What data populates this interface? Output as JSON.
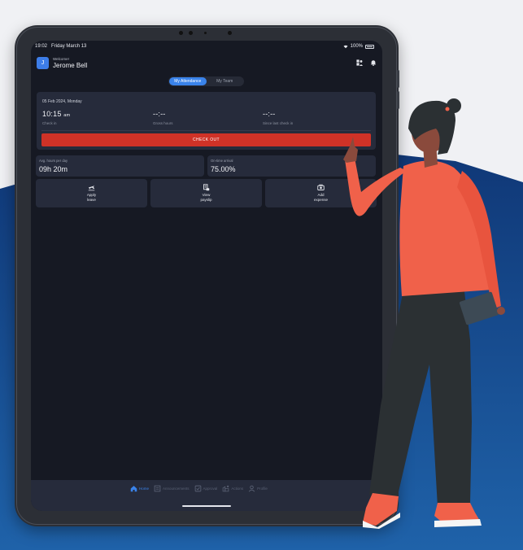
{
  "status_bar": {
    "time": "19:02",
    "date": "Friday March 13",
    "battery": "100%"
  },
  "header": {
    "avatar_initial": "J",
    "welcome": "Welcome!",
    "user_name": "Jerome Bell"
  },
  "tabs": [
    {
      "label": "My Attendance",
      "active": true
    },
    {
      "label": "My Team",
      "active": false
    }
  ],
  "attendance": {
    "date_bold": "05 Feb 2024,",
    "date_day": " Monday",
    "check_in": {
      "value": "10:15",
      "suffix": "am",
      "label": "Check in"
    },
    "gross_hours": {
      "value": "--:--",
      "label": "Gross hours"
    },
    "since_last": {
      "value": "--:--",
      "label": "Since last check in"
    },
    "checkout_label": "CHECK OUT"
  },
  "stats": [
    {
      "label": "Avg. hours per day",
      "value": "09h 20m"
    },
    {
      "label": "On-time arrival",
      "value": "75.00%"
    }
  ],
  "actions": [
    {
      "label": "Apply\nleave",
      "icon": "plane-icon"
    },
    {
      "label": "View\npayslip",
      "icon": "payslip-icon"
    },
    {
      "label": "Add\nexpense",
      "icon": "expense-icon"
    }
  ],
  "bottom_nav": [
    {
      "label": "Home",
      "icon": "home-icon",
      "active": true
    },
    {
      "label": "Announcements",
      "icon": "announcement-icon",
      "active": false
    },
    {
      "label": "Approval",
      "icon": "approval-icon",
      "active": false
    },
    {
      "label": "Actions",
      "icon": "actions-icon",
      "active": false
    },
    {
      "label": "Profile",
      "icon": "profile-icon",
      "active": false
    }
  ],
  "colors": {
    "accent": "#3a83ea",
    "checkout": "#cf3227",
    "screen_bg": "#161923",
    "card_bg": "#262b3b",
    "wave_blue": "#0f3a7a",
    "shirt": "#f0614a",
    "pants": "#2c3133"
  }
}
